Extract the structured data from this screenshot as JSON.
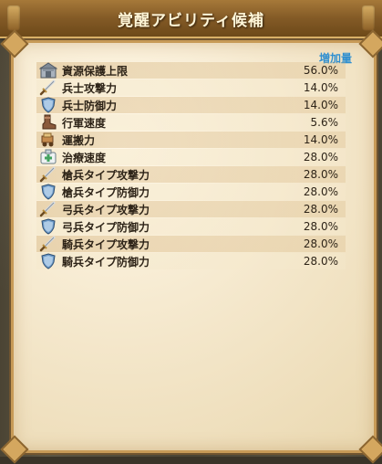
{
  "window": {
    "title": "覚醒アビリティ候補"
  },
  "table": {
    "header": "増加量",
    "rows": [
      {
        "icon": "warehouse-icon",
        "label": "資源保護上限",
        "value": "56.0%"
      },
      {
        "icon": "sword-icon",
        "label": "兵士攻撃力",
        "value": "14.0%"
      },
      {
        "icon": "shield-icon",
        "label": "兵士防御力",
        "value": "14.0%"
      },
      {
        "icon": "boot-icon",
        "label": "行軍速度",
        "value": "5.6%"
      },
      {
        "icon": "cart-icon",
        "label": "運搬力",
        "value": "14.0%"
      },
      {
        "icon": "first-aid-icon",
        "label": "治療速度",
        "value": "28.0%"
      },
      {
        "icon": "sword-icon",
        "label": "槍兵タイプ攻撃力",
        "value": "28.0%"
      },
      {
        "icon": "shield-icon",
        "label": "槍兵タイプ防御力",
        "value": "28.0%"
      },
      {
        "icon": "sword-icon",
        "label": "弓兵タイプ攻撃力",
        "value": "28.0%"
      },
      {
        "icon": "shield-icon",
        "label": "弓兵タイプ防御力",
        "value": "28.0%"
      },
      {
        "icon": "sword-icon",
        "label": "騎兵タイプ攻撃力",
        "value": "28.0%"
      },
      {
        "icon": "shield-icon",
        "label": "騎兵タイプ防御力",
        "value": "28.0%"
      }
    ]
  },
  "colors": {
    "header_text": "#2f8fd0",
    "row_text": "#2e2418",
    "title_text": "#fff6d8"
  }
}
